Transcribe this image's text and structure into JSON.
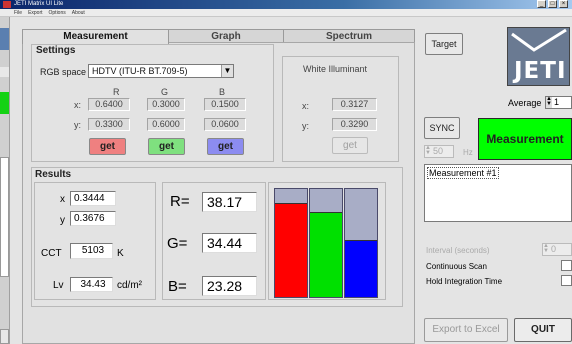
{
  "window": {
    "title": "JETI Matrix UI Lite",
    "menu": [
      "File",
      "Export",
      "Options",
      "About"
    ]
  },
  "tabs": [
    {
      "label": "Measurement",
      "active": true
    },
    {
      "label": "Graph",
      "active": false
    },
    {
      "label": "Spectrum",
      "active": false
    }
  ],
  "settings": {
    "title": "Settings",
    "rgb_space_label": "RGB space",
    "rgb_space_value": "HDTV (ITU-R BT.709-5)",
    "col_headers": [
      "R",
      "G",
      "B"
    ],
    "row_x": "x:",
    "row_y": "y:",
    "x_values": [
      "0.6400",
      "0.3000",
      "0.1500"
    ],
    "y_values": [
      "0.3300",
      "0.6000",
      "0.0600"
    ],
    "get_label": "get",
    "get_colors": [
      "#ef8080",
      "#7fe07f",
      "#8c8cf0"
    ]
  },
  "white_illuminant": {
    "title": "White Illuminant",
    "x_label": "x:",
    "x_value": "0.3127",
    "y_label": "y:",
    "y_value": "0.3290",
    "get_label": "get"
  },
  "results": {
    "title": "Results",
    "x_label": "x",
    "x_value": "0.3444",
    "y_label": "y",
    "y_value": "0.3676",
    "cct_label": "CCT",
    "cct_value": "5103",
    "cct_unit": "K",
    "lv_label": "Lv",
    "lv_value": "34.43",
    "lv_unit": "cd/m²",
    "r_label": "R=",
    "r_value": "38.17",
    "g_label": "G=",
    "g_value": "34.44",
    "b_label": "B=",
    "b_value": "23.28"
  },
  "rgb_bars": {
    "colors": {
      "r": "#ff0000",
      "g": "#00e000",
      "b": "#0000ff",
      "empty": "#a8adc6"
    }
  },
  "right_panel": {
    "target_label": "Target",
    "logo_text": "JETI",
    "average_label": "Average",
    "average_value": "1",
    "sync_label": "SYNC",
    "sync_value": "50",
    "sync_unit": "Hz",
    "measure_label": "Measurement",
    "measure_color": "#00ff00",
    "list_items": [
      "Measurement #1"
    ],
    "interval_label": "Interval  (seconds)",
    "interval_value": "0",
    "continuous_label": "Continuous Scan",
    "hold_label": "Hold Integration Time",
    "export_label": "Export to Excel",
    "quit_label": "QUIT"
  }
}
